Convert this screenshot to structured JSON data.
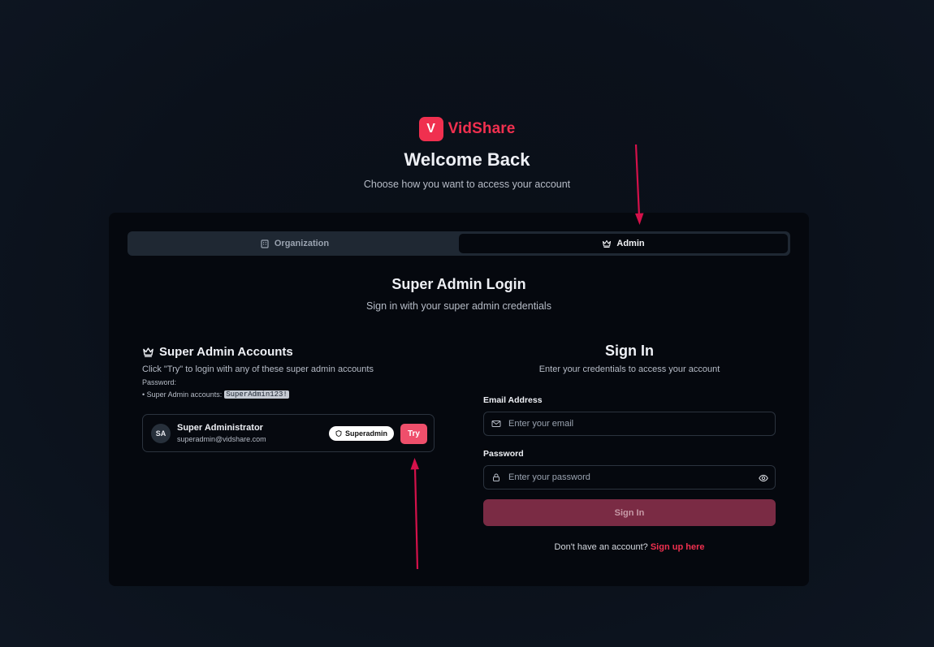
{
  "brand": {
    "logo_letter": "V",
    "name": "VidShare",
    "color": "#f0304f"
  },
  "header": {
    "title": "Welcome Back",
    "subtitle": "Choose how you want to access your account"
  },
  "tabs": [
    {
      "label": "Organization",
      "icon": "building-icon",
      "active": false
    },
    {
      "label": "Admin",
      "icon": "crown-icon",
      "active": true
    }
  ],
  "login": {
    "title": "Super Admin Login",
    "subtitle": "Sign in with your super admin credentials"
  },
  "accounts": {
    "title": "Super Admin Accounts",
    "description": "Click \"Try\" to login with any of these super admin accounts",
    "password_label": "Password:",
    "list_label": "• Super Admin accounts:",
    "password_value": "SuperAdmin123!",
    "items": [
      {
        "initials": "SA",
        "name": "Super Administrator",
        "email": "superadmin@vidshare.com",
        "role": "Superadmin",
        "try_label": "Try"
      }
    ]
  },
  "signin": {
    "title": "Sign In",
    "subtitle": "Enter your credentials to access your account",
    "email_label": "Email Address",
    "email_placeholder": "Enter your email",
    "password_label": "Password",
    "password_placeholder": "Enter your password",
    "button_label": "Sign In",
    "signup_prompt": "Don't have an account?",
    "signup_link": "Sign up here"
  },
  "colors": {
    "accent": "#f0304f",
    "try_button": "#ef4f6b",
    "signin_button": "#7a2b44",
    "annotation_arrow": "#d4114a"
  }
}
